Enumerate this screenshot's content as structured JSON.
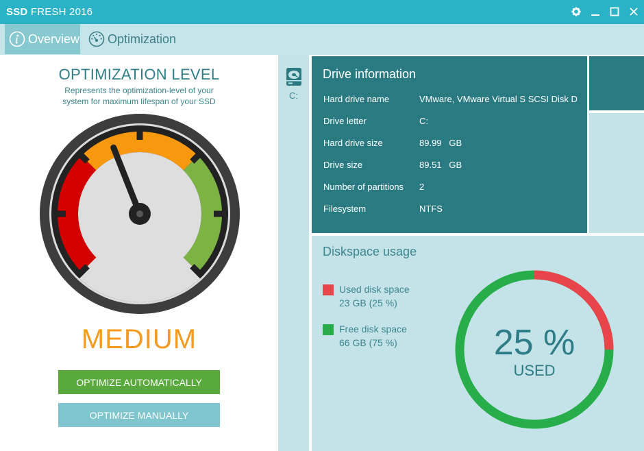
{
  "window": {
    "title_bold": "SSD",
    "title_rest": "FRESH 2016",
    "controls": [
      "settings",
      "minimize",
      "maximize",
      "close"
    ]
  },
  "tabs": [
    {
      "label": "Overview",
      "icon": "info-icon",
      "active": true
    },
    {
      "label": "Optimization",
      "icon": "speedometer-icon",
      "active": false
    }
  ],
  "optimization": {
    "title": "OPTIMIZATION LEVEL",
    "subtitle_line1": "Represents the optimization-level of your",
    "subtitle_line2": "system for maximum lifespan of your SSD",
    "level": "MEDIUM",
    "gauge_value_fraction": 0.42,
    "auto_button": "OPTIMIZE AUTOMATICALLY",
    "manual_button": "OPTIMIZE MANUALLY"
  },
  "drives": [
    {
      "letter": "C:",
      "icon": "hard-drive-icon",
      "selected": true
    }
  ],
  "drive_info": {
    "title": "Drive information",
    "rows": [
      {
        "key": "Hard drive name",
        "value": "VMware, VMware Virtual S SCSI Disk D"
      },
      {
        "key": "Drive letter",
        "value": "C:"
      },
      {
        "key": "Hard drive size",
        "value": "89.99   GB"
      },
      {
        "key": "Drive size",
        "value": "89.51   GB"
      },
      {
        "key": "Number of partitions",
        "value": "2"
      },
      {
        "key": "Filesystem",
        "value": "NTFS"
      }
    ]
  },
  "diskspace": {
    "title": "Diskspace usage",
    "used": {
      "label": "Used disk space",
      "detail": "23 GB (25 %)",
      "color": "#e8454b",
      "percent": 25
    },
    "free": {
      "label": "Free disk space",
      "detail": "66 GB (75 %)",
      "color": "#27ad4a",
      "percent": 75
    },
    "center_value": "25 %",
    "center_label": "USED"
  },
  "colors": {
    "titlebar": "#2ab3c6",
    "accent_teal": "#2a7a82",
    "light_panel": "#c3e3e8",
    "level_orange": "#f49a1e",
    "auto_green": "#5aa93d"
  }
}
